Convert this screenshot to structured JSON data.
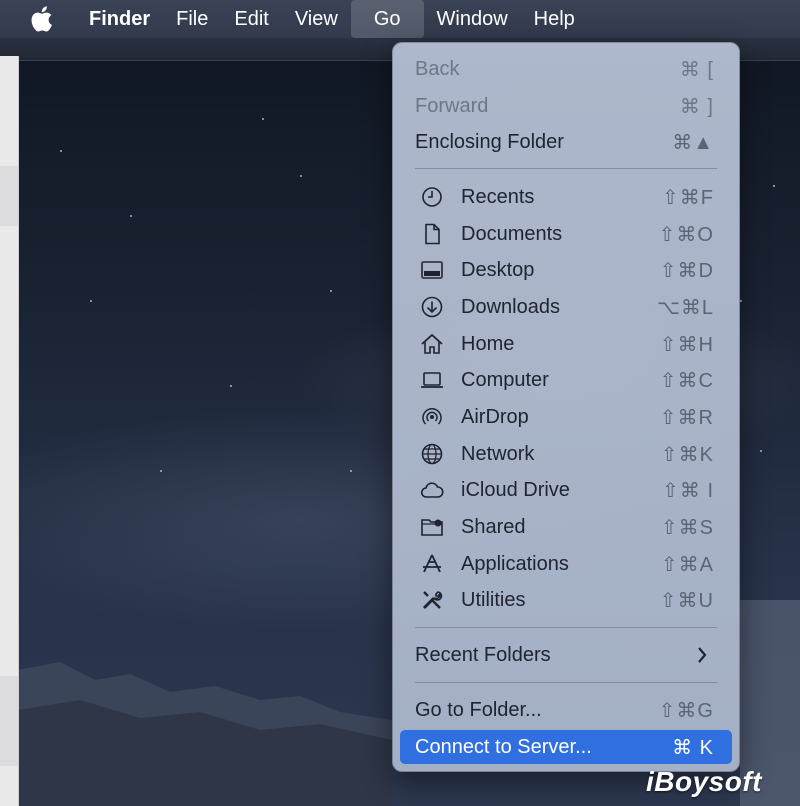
{
  "menubar": {
    "apple_icon": "apple-logo-icon",
    "items": [
      "Finder",
      "File",
      "Edit",
      "View",
      "Go",
      "Window",
      "Help"
    ],
    "active": "Go"
  },
  "go_menu": {
    "section1": [
      {
        "label": "Back",
        "shortcut": "⌘ [",
        "disabled": true
      },
      {
        "label": "Forward",
        "shortcut": "⌘ ]",
        "disabled": true
      },
      {
        "label": "Enclosing Folder",
        "shortcut": "⌘▲",
        "disabled": false
      }
    ],
    "section2": [
      {
        "label": "Recents",
        "shortcut": "⇧⌘F",
        "icon": "clock-icon"
      },
      {
        "label": "Documents",
        "shortcut": "⇧⌘O",
        "icon": "document-icon"
      },
      {
        "label": "Desktop",
        "shortcut": "⇧⌘D",
        "icon": "desktop-icon"
      },
      {
        "label": "Downloads",
        "shortcut": "⌥⌘L",
        "icon": "download-icon"
      },
      {
        "label": "Home",
        "shortcut": "⇧⌘H",
        "icon": "home-icon"
      },
      {
        "label": "Computer",
        "shortcut": "⇧⌘C",
        "icon": "laptop-icon"
      },
      {
        "label": "AirDrop",
        "shortcut": "⇧⌘R",
        "icon": "airdrop-icon"
      },
      {
        "label": "Network",
        "shortcut": "⇧⌘K",
        "icon": "globe-icon"
      },
      {
        "label": "iCloud Drive",
        "shortcut": "⇧⌘ I",
        "icon": "cloud-icon"
      },
      {
        "label": "Shared",
        "shortcut": "⇧⌘S",
        "icon": "shared-folder-icon"
      },
      {
        "label": "Applications",
        "shortcut": "⇧⌘A",
        "icon": "applications-icon"
      },
      {
        "label": "Utilities",
        "shortcut": "⇧⌘U",
        "icon": "tools-icon"
      }
    ],
    "recent_folders": {
      "label": "Recent Folders",
      "icon": "chevron-right-icon"
    },
    "section4": [
      {
        "label": "Go to Folder...",
        "shortcut": "⇧⌘G"
      },
      {
        "label": "Connect to Server...",
        "shortcut": "⌘ K",
        "highlighted": true
      }
    ]
  },
  "watermark": "iBoysoft",
  "colors": {
    "highlight": "#2f6fe0",
    "menubar": "#343c4e"
  }
}
